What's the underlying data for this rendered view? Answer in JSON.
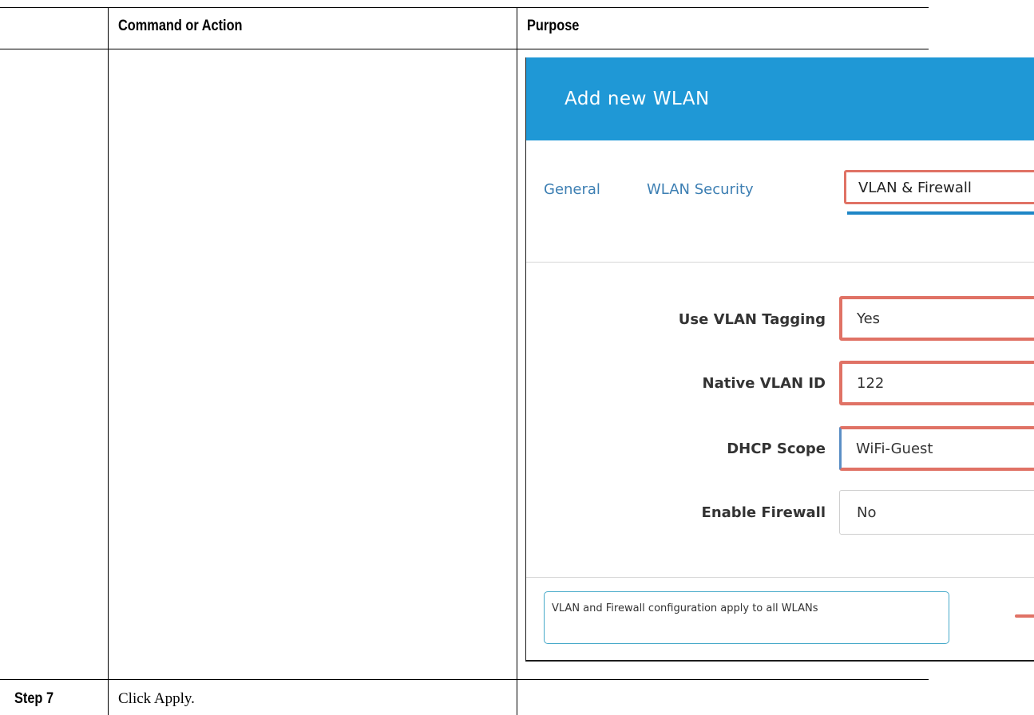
{
  "table": {
    "col_action_header": "Command or Action",
    "col_purpose_header": "Purpose",
    "step_label": "Step 7",
    "step_text": "Click Apply."
  },
  "dialog": {
    "title": "Add new WLAN",
    "tabs": [
      {
        "label": "General",
        "active": false
      },
      {
        "label": "WLAN Security",
        "active": false
      },
      {
        "label": "VLAN & Firewall",
        "active": true
      }
    ],
    "fields": [
      {
        "label": "Use VLAN Tagging",
        "value": "Yes",
        "highlighted": true
      },
      {
        "label": "Native VLAN ID",
        "value": "122",
        "highlighted": true
      },
      {
        "label": "DHCP Scope",
        "value": "WiFi-Guest",
        "highlighted": true
      },
      {
        "label": "Enable Firewall",
        "value": "No",
        "highlighted": false
      }
    ],
    "note": "VLAN and Firewall configuration apply to all WLANs"
  },
  "colors": {
    "header_blue": "#1f98d6",
    "highlight_red": "#e07265",
    "tab_link": "#3d7fb3",
    "note_border": "#46a9c9"
  }
}
